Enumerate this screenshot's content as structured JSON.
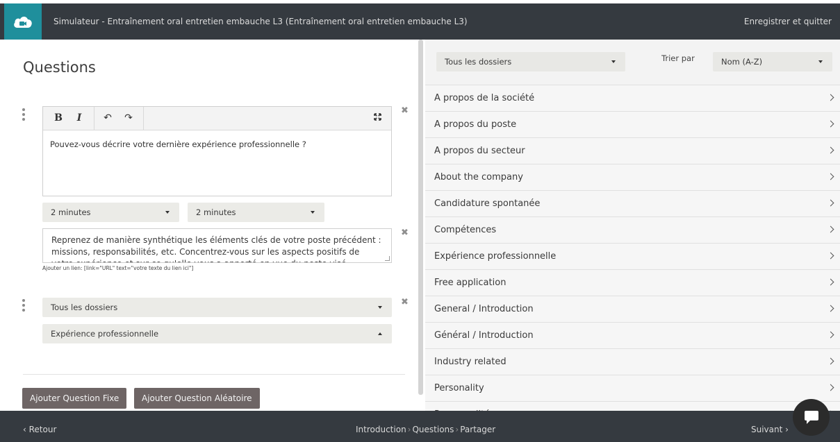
{
  "header": {
    "title": "Simulateur - Entraînement oral entretien embauche L3 (Entraînement oral entretien embauche L3)",
    "save_quit": "Enregistrer et quitter"
  },
  "questions": {
    "title": "Questions",
    "editor": {
      "bold": "B",
      "italic": "I",
      "undo": "↶",
      "redo": "↷",
      "text": "Pouvez-vous décrire votre dernière expérience professionnelle ?"
    },
    "duration_1": "2 minutes",
    "duration_2": "2 minutes",
    "hint_text": "Reprenez de manière synthétique les éléments clés de votre poste précédent : missions, responsabilités, etc. Concentrez-vous sur les aspects positifs de votre expérience et sur ce qu'elle vous a apporté en vue du poste visé.",
    "link_help": "Ajouter un lien: [link=\"URL\" text=\"votre texte du lien ici\"]",
    "random_folder": "Tous les dossiers",
    "random_category": "Expérience professionnelle",
    "add_fixed": "Ajouter Question Fixe",
    "add_random": "Ajouter Question Aléatoire"
  },
  "library": {
    "folder_filter": "Tous les dossiers",
    "sort_label": "Trier par",
    "sort_value": "Nom (A-Z)",
    "folders": [
      "A propos de la société",
      "A propos du poste",
      "A propos du secteur",
      "About the company",
      "Candidature spontanée",
      "Compétences",
      "Expérience professionnelle",
      "Free application",
      "General / Introduction",
      "Général / Introduction",
      "Industry related",
      "Personality",
      "Personnalité"
    ]
  },
  "footer": {
    "back": "‹ Retour",
    "step_1": "Introduction",
    "step_2": "Questions",
    "step_3": "Partager",
    "next": "Suivant ›"
  },
  "colors": {
    "topbar": "#353a40",
    "logo": "#1f8f9c",
    "button": "#6e6565"
  }
}
